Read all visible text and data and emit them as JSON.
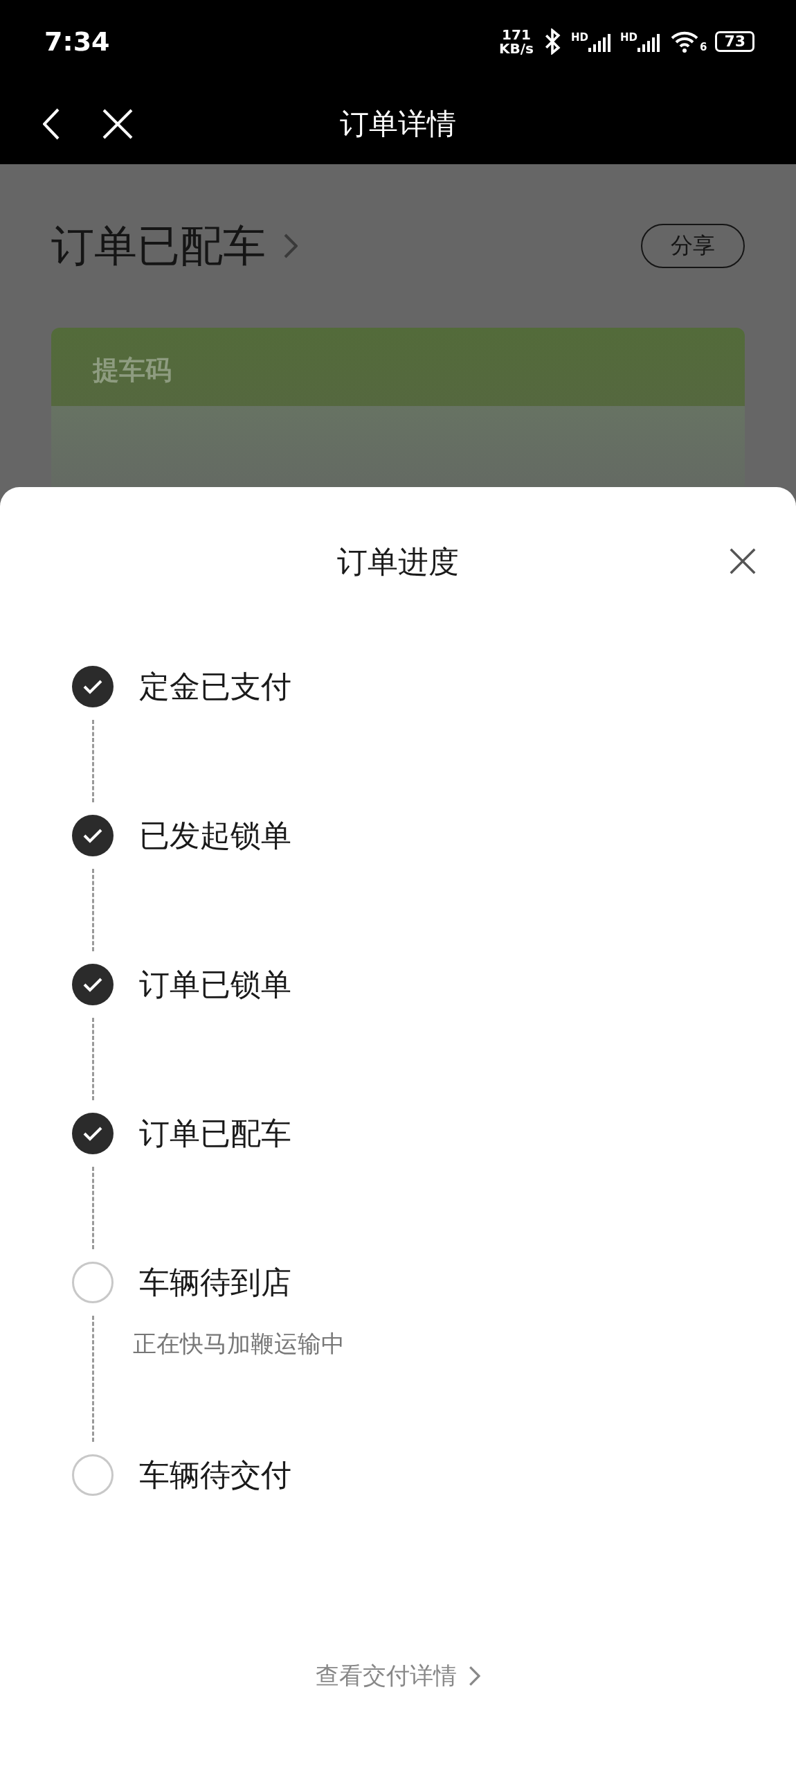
{
  "status_bar": {
    "time": "7:34",
    "speed_value": "171",
    "speed_unit": "KB/s",
    "signal_labels": [
      "HD",
      "HD"
    ],
    "wifi_label": "6",
    "battery": "73"
  },
  "nav": {
    "title": "订单详情"
  },
  "background_page": {
    "status": "订单已配车",
    "share_button": "分享",
    "card_title": "提车码"
  },
  "sheet": {
    "title": "订单进度",
    "steps": [
      {
        "label": "定金已支付",
        "done": true
      },
      {
        "label": "已发起锁单",
        "done": true
      },
      {
        "label": "订单已锁单",
        "done": true
      },
      {
        "label": "订单已配车",
        "done": true
      },
      {
        "label": "车辆待到店",
        "done": false,
        "note": "正在快马加鞭运输中"
      },
      {
        "label": "车辆待交付",
        "done": false
      }
    ],
    "link": "查看交付详情"
  }
}
